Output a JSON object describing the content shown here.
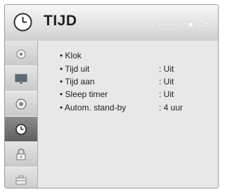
{
  "header": {
    "title": "TIJD",
    "hint_move": "Verplaatsen",
    "hint_ok": "OK",
    "icon": "clock-icon"
  },
  "sidebar": {
    "items": [
      {
        "name": "satellite-dish-icon"
      },
      {
        "name": "monitor-icon"
      },
      {
        "name": "speaker-icon"
      },
      {
        "name": "clock-icon",
        "active": true
      },
      {
        "name": "lock-icon"
      },
      {
        "name": "toolbox-icon"
      }
    ]
  },
  "menu": {
    "items": [
      {
        "label": "• Klok",
        "value": ""
      },
      {
        "label": "• Tijd uit",
        "value": ": Uit"
      },
      {
        "label": "• Tijd aan",
        "value": ": Uit"
      },
      {
        "label": "• Sleep timer",
        "value": ": Uit"
      },
      {
        "label": "• Autom. stand-by",
        "value": ": 4 uur"
      }
    ]
  },
  "colors": {
    "active_tab": "#6e6e6e",
    "background": "#e8e8e8"
  }
}
